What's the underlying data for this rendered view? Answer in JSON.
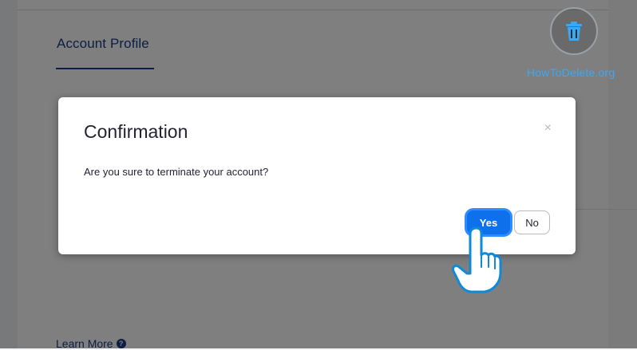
{
  "page": {
    "tab_title": "Account Profile",
    "learn_more": "Learn More"
  },
  "dialog": {
    "title": "Confirmation",
    "close_glyph": "×",
    "message": "Are you sure to terminate your account?",
    "yes_label": "Yes",
    "no_label": "No"
  },
  "watermark": {
    "text": "HowToDelete.org",
    "icon": "trash-icon"
  },
  "colors": {
    "accent": "#0e71eb",
    "brand_dark": "#1b3c8a",
    "watermark": "#39a9f5"
  }
}
